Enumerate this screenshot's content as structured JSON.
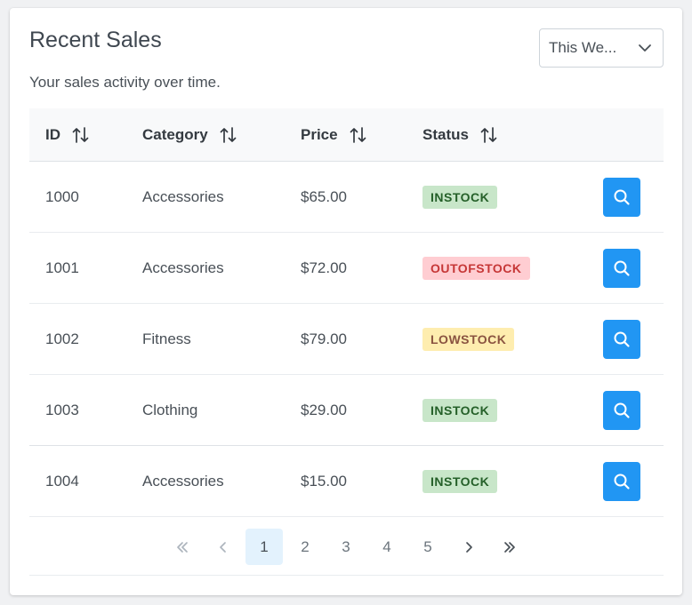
{
  "card": {
    "title": "Recent Sales",
    "subtitle": "Your sales activity over time."
  },
  "period_select": {
    "selected": "This We...",
    "icon": "chevron-down-icon"
  },
  "table": {
    "headers": [
      {
        "label": "ID",
        "icon": "sort-icon"
      },
      {
        "label": "Category",
        "icon": "sort-icon"
      },
      {
        "label": "Price",
        "icon": "sort-icon"
      },
      {
        "label": "Status",
        "icon": "sort-icon"
      }
    ],
    "rows": [
      {
        "id": "1000",
        "category": "Accessories",
        "price": "$65.00",
        "status": "INSTOCK"
      },
      {
        "id": "1001",
        "category": "Accessories",
        "price": "$72.00",
        "status": "OUTOFSTOCK"
      },
      {
        "id": "1002",
        "category": "Fitness",
        "price": "$79.00",
        "status": "LOWSTOCK"
      },
      {
        "id": "1003",
        "category": "Clothing",
        "price": "$29.00",
        "status": "INSTOCK"
      },
      {
        "id": "1004",
        "category": "Accessories",
        "price": "$15.00",
        "status": "INSTOCK"
      }
    ],
    "row_action_icon": "search-icon"
  },
  "pagination": {
    "pages": [
      "1",
      "2",
      "3",
      "4",
      "5"
    ],
    "current_page": "1",
    "first_icon": "double-chevron-left-icon",
    "prev_icon": "chevron-left-icon",
    "next_icon": "chevron-right-icon",
    "last_icon": "double-chevron-right-icon"
  },
  "colors": {
    "accent": "#2196f3",
    "instock_bg": "#c8e6c9",
    "instock_text": "#256029",
    "outofstock_bg": "#ffcdd2",
    "outofstock_text": "#c63737",
    "lowstock_bg": "#feedaf",
    "lowstock_text": "#8a5340"
  }
}
